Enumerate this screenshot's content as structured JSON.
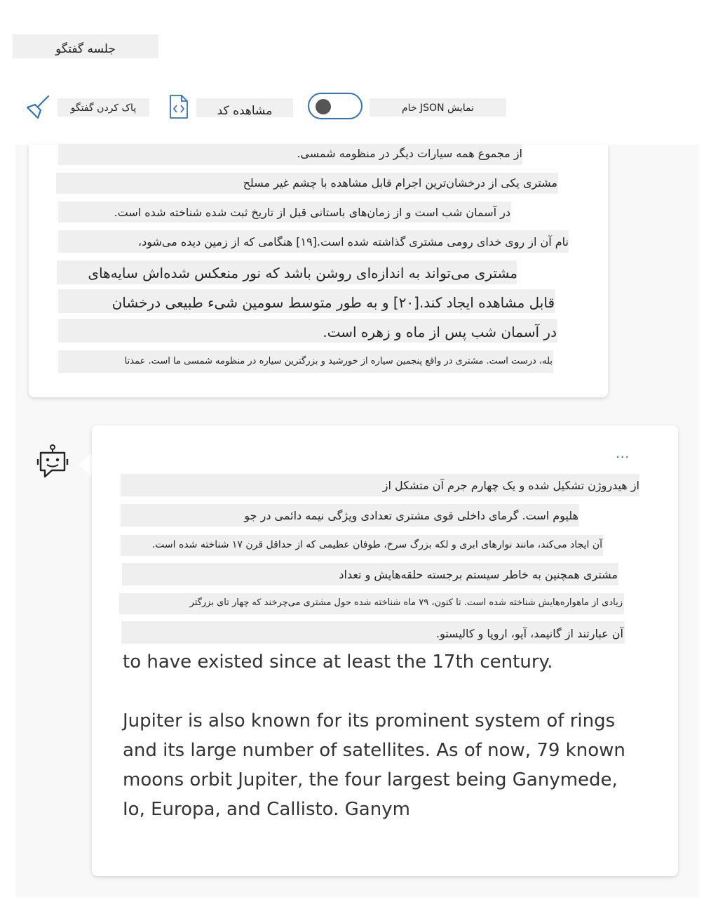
{
  "header": {
    "session_title": "جلسه گفتگو"
  },
  "toolbar": {
    "clear_label": "پاک کردن گفتگو",
    "view_code_label": "مشاهده کد",
    "show_raw_json_label": "نمایش JSON خام",
    "raw_json_toggle": false
  },
  "user_message": {
    "lines": [
      "از مجموع همه سیارات دیگر در منظومه شمسی.",
      "مشتری یکی از درخشان‌ترین اجرام قابل مشاهده با چشم غیر مسلح",
      "در آسمان شب است و از زمان‌های باستانی قبل از تاریخ ثبت شده شناخته شده است.",
      "نام آن از روی خدای رومی مشتری گذاشته شده است.[۱۹] هنگامی که از زمین دیده می‌شود،",
      "مشتری می‌تواند به اندازه‌ای روشن باشد که نور منعکس شده‌اش سایه‌های",
      "قابل مشاهده ایجاد کند.[۲۰] و به طور متوسط سومین شیء طبیعی درخشان",
      "در آسمان شب پس از ماه و زهره است.",
      "بله، درست است. مشتری در واقع پنجمین سیاره از خورشید و بزرگترین سیاره در منظومه شمسی ما است. عمدتا"
    ]
  },
  "bot_message": {
    "more_label": "...",
    "rtl_lines": [
      "از هیدروژن تشکیل شده و یک چهارم جرم آن متشکل از",
      "هلیوم است. گرمای داخلی قوی مشتری تعدادی ویژگی نیمه دائمی در جو",
      "آن ایجاد می‌کند، مانند نوارهای ابری و لکه بزرگ سرخ، طوفان عظیمی که از حداقل قرن ۱۷ شناخته شده است.",
      "مشتری همچنین به خاطر سیستم برجسته حلقه‌هایش و تعداد",
      "زیادی از ماهواره‌هایش شناخته شده است. تا کنون، ۷۹ ماه شناخته شده حول مشتری می‌چرخند که چهار تای بزرگتر",
      "آن عبارتند از گانیمد، آیو، اروپا و کالیستو."
    ],
    "en_line_1": "to have existed since at least the 17th century.",
    "en_paragraph": "Jupiter is also known for its prominent system of rings and its large number of satellites. As of now, 79 known moons orbit Jupiter, the four largest being Ganymede, Io, Europa, and Callisto. Ganym"
  },
  "colors": {
    "accent": "#2f72c5",
    "highlight": "#efefef",
    "chat_background": "#f8f8f8"
  },
  "icons": {
    "clear": "broom-icon",
    "view_code": "code-file-icon",
    "bot_avatar": "bot-icon"
  }
}
